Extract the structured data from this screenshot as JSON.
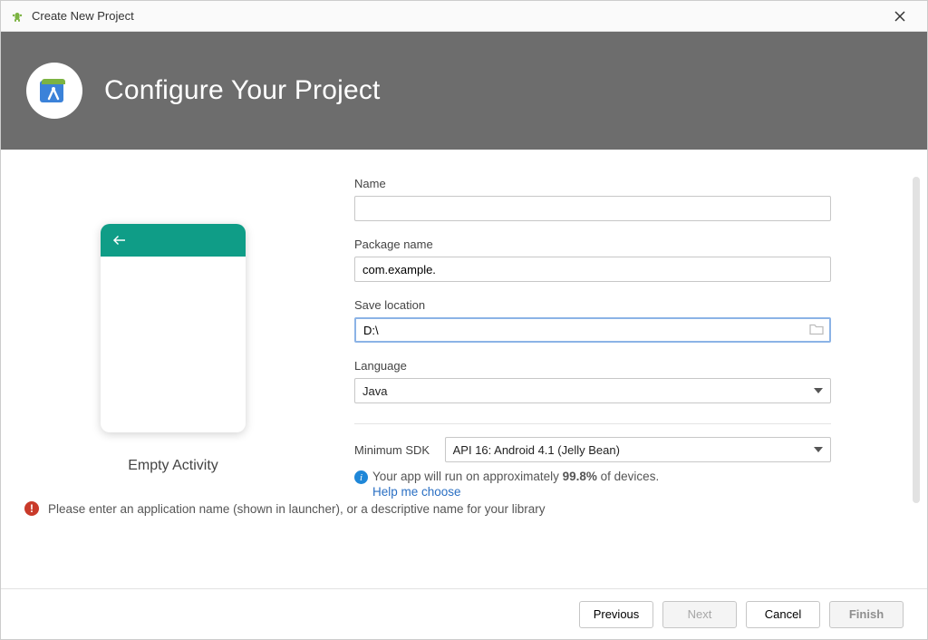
{
  "window": {
    "title": "Create New Project"
  },
  "header": {
    "heading": "Configure Your Project"
  },
  "preview": {
    "caption": "Empty Activity"
  },
  "form": {
    "name": {
      "label": "Name",
      "value": ""
    },
    "package": {
      "label": "Package name",
      "value": "com.example."
    },
    "save_location": {
      "label": "Save location",
      "value": "D:\\"
    },
    "language": {
      "label": "Language",
      "value": "Java"
    },
    "min_sdk": {
      "label": "Minimum SDK",
      "value": "API 16: Android 4.1 (Jelly Bean)"
    },
    "hint": {
      "line1_pre": "Your app will run on approximately ",
      "line1_strong": "99.8%",
      "line1_post": " of devices.",
      "line2": "Help me choose"
    }
  },
  "error": {
    "text": "Please enter an application name (shown in launcher), or a descriptive name for your library"
  },
  "footer": {
    "previous": "Previous",
    "next": "Next",
    "cancel": "Cancel",
    "finish": "Finish"
  }
}
